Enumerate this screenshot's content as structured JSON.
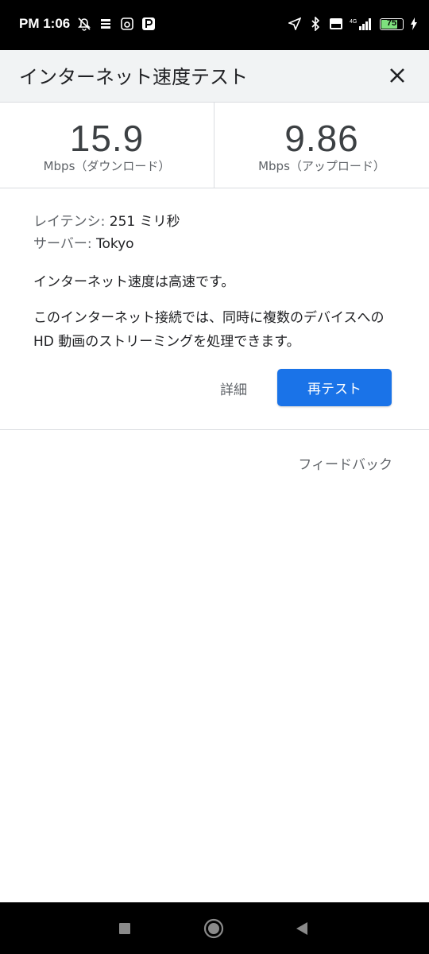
{
  "status_bar": {
    "time": "PM 1:06",
    "battery": "75",
    "left_icons": [
      "alarm-off-icon",
      "notification-icon",
      "app-icon",
      "paypay-icon"
    ],
    "right_icons": [
      "location-icon",
      "bluetooth-icon",
      "volte-icon",
      "signal-4g-icon"
    ]
  },
  "header": {
    "title": "インターネット速度テスト"
  },
  "results": {
    "download_value": "15.9",
    "download_label": "Mbps（ダウンロード）",
    "upload_value": "9.86",
    "upload_label": "Mbps（アップロード）"
  },
  "details": {
    "latency_label": "レイテンシ:",
    "latency_value": " 251 ミリ秒",
    "server_label": "サーバー:",
    "server_value": " Tokyo",
    "status": "インターネット速度は高速です。",
    "description": "このインターネット接続では、同時に複数のデバイスへの HD 動画のストリーミングを処理できます。"
  },
  "actions": {
    "details_link": "詳細",
    "retest_button": "再テスト",
    "feedback_link": "フィードバック"
  },
  "colors": {
    "accent": "#1a73e8",
    "header_bg": "#f1f3f4",
    "battery": "#7ee07e"
  }
}
